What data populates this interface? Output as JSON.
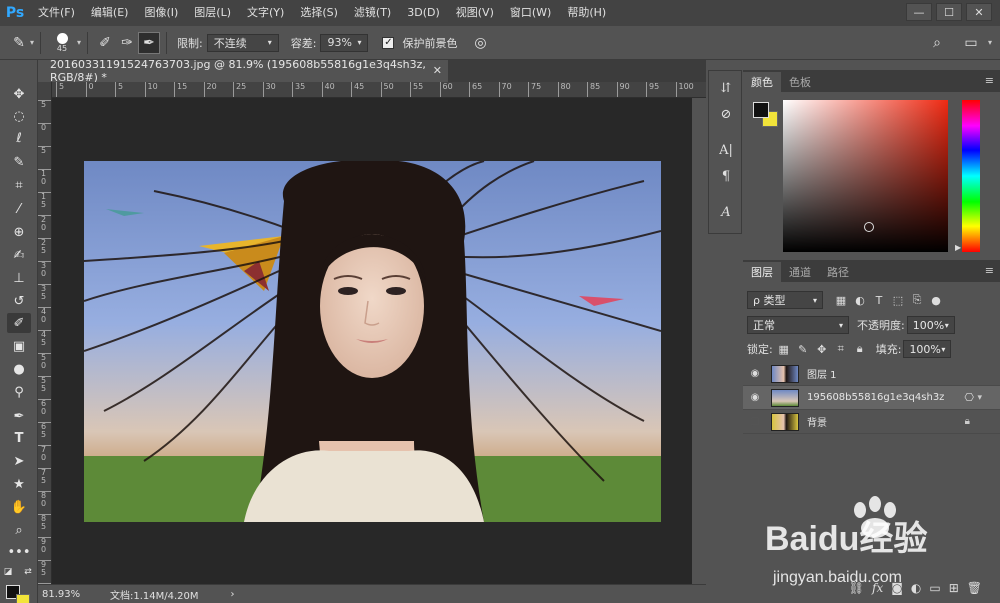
{
  "app": {
    "logo": "Ps"
  },
  "menu": [
    "文件(F)",
    "编辑(E)",
    "图像(I)",
    "图层(L)",
    "文字(Y)",
    "选择(S)",
    "滤镜(T)",
    "3D(D)",
    "视图(V)",
    "窗口(W)",
    "帮助(H)"
  ],
  "window_controls": {
    "minimize": "—",
    "maximize": "☐",
    "close": "✕"
  },
  "options": {
    "brush_size": "45",
    "limit_label": "限制:",
    "limit_value": "不连续",
    "tolerance_label": "容差:",
    "tolerance_value": "93%",
    "protect_label": "保护前景色",
    "protect_checked": true
  },
  "document": {
    "tab_title": "20160331191524763703.jpg @ 81.9% (195608b55816g1e3q4sh3z, RGB/8#) *",
    "ruler_h": [
      "5",
      "0",
      "5",
      "10",
      "15",
      "20",
      "25",
      "30",
      "35",
      "40",
      "45",
      "50",
      "55",
      "60",
      "65",
      "70",
      "75",
      "80",
      "85",
      "90",
      "95",
      "100"
    ],
    "ruler_v": [
      "5",
      "0",
      "5",
      "10",
      "15",
      "20",
      "25",
      "30",
      "35",
      "40",
      "45",
      "50",
      "55",
      "60",
      "65",
      "70",
      "75",
      "80",
      "85",
      "90",
      "95",
      "100"
    ],
    "status_zoom": "81.93%",
    "status_doc": "文档:1.14M/4.20M",
    "status_arrow": "›"
  },
  "colors": {
    "foreground": "#111111",
    "background": "#f2e43a",
    "accent": "#31a8ff"
  },
  "color_panel": {
    "tabs": [
      "颜色",
      "色板"
    ]
  },
  "layers_panel": {
    "tabs": [
      "图层",
      "通道",
      "路径"
    ],
    "filter_label": "ρ 类型",
    "blend_mode": "正常",
    "opacity_label": "不透明度:",
    "opacity_value": "100%",
    "lock_label": "锁定:",
    "fill_label": "填充:",
    "fill_value": "100%",
    "layers": [
      {
        "name": "图层 1",
        "visible": true,
        "selected": false
      },
      {
        "name": "195608b55816g1e3q4sh3z",
        "visible": true,
        "selected": true
      },
      {
        "name": "背景",
        "visible": false,
        "selected": false,
        "locked": true
      }
    ]
  },
  "watermark": {
    "brand": "Baidu经验",
    "url": "jingyan.baidu.com"
  }
}
